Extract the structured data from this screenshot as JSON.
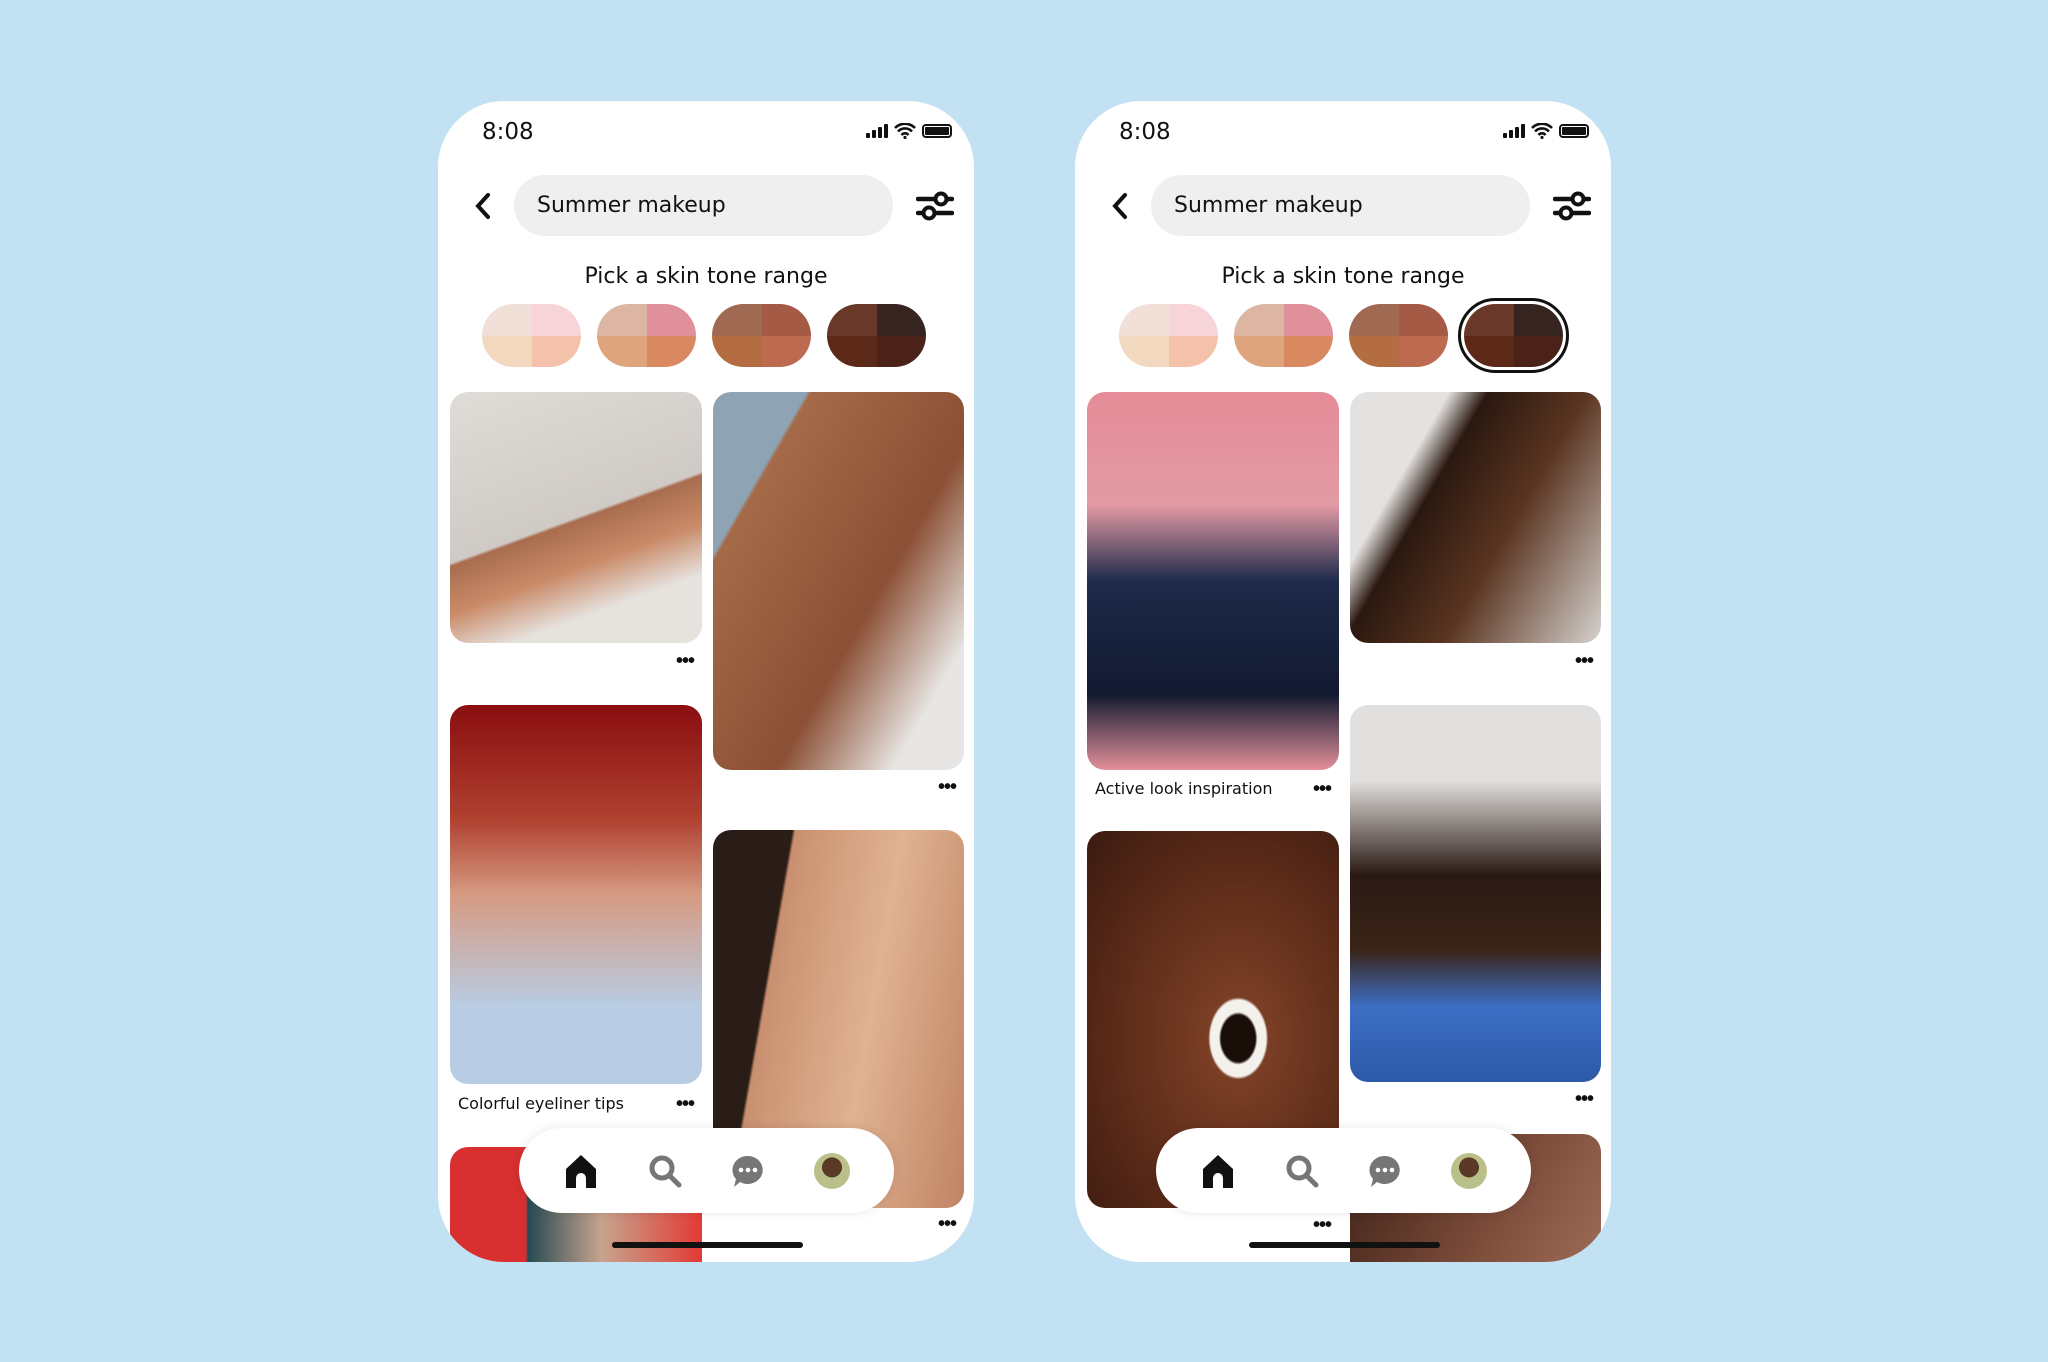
{
  "phones": [
    {
      "status": {
        "time": "8:08"
      },
      "search": {
        "value": "Summer makeup"
      },
      "skin_tone": {
        "title": "Pick a skin tone range",
        "selected_index": null
      },
      "pins": [
        {
          "caption": "",
          "menu": "•••"
        },
        {
          "caption": "",
          "menu": "•••"
        },
        {
          "caption": "Colorful eyeliner tips",
          "menu": "•••"
        },
        {
          "caption": "",
          "menu": "•••"
        }
      ]
    },
    {
      "status": {
        "time": "8:08"
      },
      "search": {
        "value": "Summer makeup"
      },
      "skin_tone": {
        "title": "Pick a skin tone range",
        "selected_index": 3
      },
      "pins": [
        {
          "caption": "Active look inspiration",
          "menu": "•••"
        },
        {
          "caption": "",
          "menu": "•••"
        },
        {
          "caption": "",
          "menu": "•••"
        },
        {
          "caption": "",
          "menu": "•••"
        }
      ]
    }
  ],
  "skin_tone_swatches": [
    [
      "#f0e0d8",
      "#f6d4d8",
      "#f1d8be",
      "#f4c2ab"
    ],
    [
      "#dcb6a2",
      "#e0909a",
      "#dea57c",
      "#d9895f"
    ],
    [
      "#a06a52",
      "#a45a45",
      "#b46d41",
      "#bc6a50"
    ],
    [
      "#6a3828",
      "#352420",
      "#5c2818",
      "#4a2218"
    ]
  ],
  "nav": [
    "home-icon",
    "search-icon",
    "messages-icon",
    "profile-avatar"
  ],
  "colors": {
    "background": "#c2e1f2",
    "search_bg": "#efefef",
    "active_nav": "#111111",
    "inactive_nav": "#767676"
  }
}
